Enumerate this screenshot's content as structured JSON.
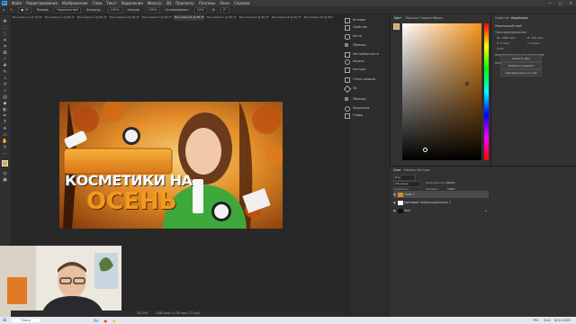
{
  "menu": {
    "logo": "Ps",
    "items": [
      "Файл",
      "Редактирование",
      "Изображение",
      "Слои",
      "Текст",
      "Выделение",
      "Фильтр",
      "3D",
      "Просмотр",
      "Плагины",
      "Окно",
      "Справка"
    ]
  },
  "options": {
    "mode_label": "Режим:",
    "mode_value": "Нормальный",
    "opacity_label": "Непрозр.:",
    "opacity_value": "100%",
    "flow_label": "Нажим:",
    "flow_value": "100%",
    "smoothing_label": "Сглаживание:",
    "smoothing_value": "10%",
    "angle": "0°"
  },
  "tabs": [
    "Без имени-1 @ 33,3% (Слой 1, RGB/8)",
    "Без имени-2 @ 66,7% (RGB/8)",
    "Без имени-3 @ 66,7% (Слой 1, RGB/8)",
    "Без имени-4 @ 66,7% (RGB/8)",
    "Без имени-5 @ 66,7% (RGB/8)",
    "Без имени-6 @ 66,7% (Слой 1, RGB/8)",
    "Без имени-7 @ 66,7% (RGB/8)",
    "Без имени-8 @ 66,7% (Слой 1, RGB/8)",
    "Без имени-9 @ 66,7% (Слой 1, RGB/8)",
    "Без имени-10 @ 66,7% (RGB/8)"
  ],
  "thumbnail": {
    "line1": "КОСМЕТИКИ НА",
    "line2": "ОСЕНЬ"
  },
  "mid_panel": [
    "История",
    "Свойства",
    "Кисти",
    "Образцы",
    "Настройки кисти",
    "Каналы",
    "Контуры",
    "Стили символа",
    "3D",
    "Образцы",
    "Коррекция",
    "Глифы"
  ],
  "color_tabs": [
    "Цвет",
    "Образцы",
    "Градиенты",
    "Узоры"
  ],
  "props_tabs": [
    "Свойства",
    "Коррекция"
  ],
  "props": {
    "doc_title": "Пиксельный слой",
    "section_transform": "Трансформирование",
    "w": "Ш: 1280 пикс",
    "h": "В: 720 пикс",
    "x": "X: 0 пикс",
    "y": "Y: 0 пикс",
    "angle": "0,00°",
    "section_align": "Выравнивание и распределение",
    "section_quick": "Быстрые действия",
    "btn1": "Удалить фон",
    "btn2": "Выбрать предмет",
    "btn3": "Преобразовать в слой"
  },
  "layers": {
    "tabs": [
      "Слои",
      "Каналы",
      "Контуры"
    ],
    "kind_label": "Вид",
    "blend_value": "Обычные",
    "opacity_label": "Непрозрачность:",
    "opacity_value": "100%",
    "lock_label": "Закрепить:",
    "fill_label": "Заливка:",
    "fill_value": "100%",
    "rows": [
      "Слой 1",
      "Цветовой тон/Насыщенность 1",
      "Фон"
    ]
  },
  "status": {
    "zoom": "33,33%",
    "size": "1280 пикс x 720 пикс (72 ppi)"
  },
  "taskbar": {
    "search": "Поиск",
    "time": "8:42",
    "date": "02.10.2023",
    "lang": "РУС"
  },
  "colors": {
    "accent": "#31a8ff",
    "fg_swatch": "#e8a246",
    "picker_base": "#f7941d"
  }
}
